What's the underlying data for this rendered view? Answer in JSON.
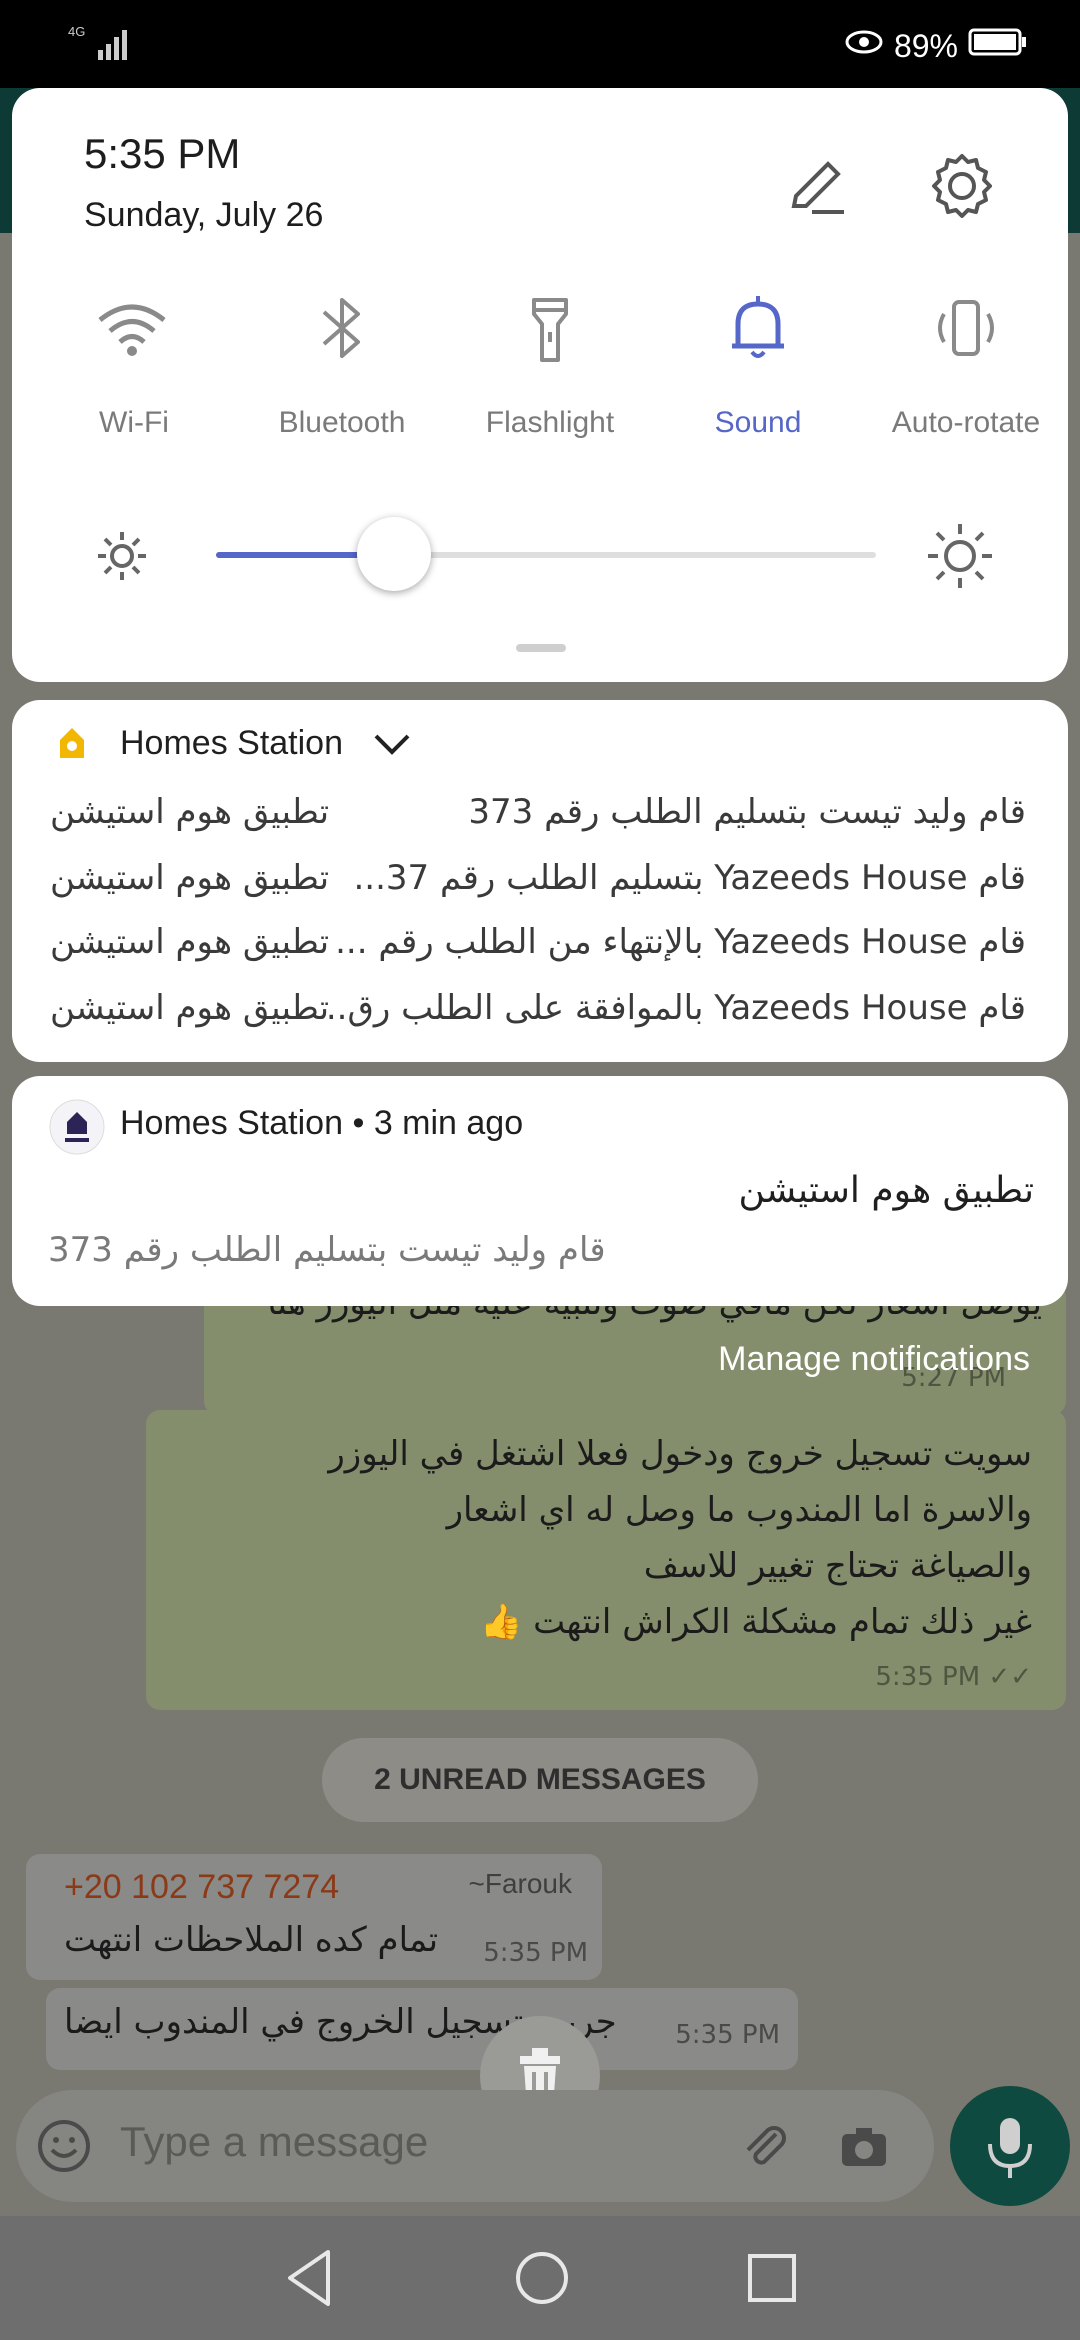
{
  "status_bar": {
    "network": "4G",
    "battery": "89%"
  },
  "quick_settings": {
    "time": "5:35 PM",
    "date": "Sunday, July 26",
    "tiles": [
      {
        "label": "Wi-Fi",
        "icon": "wifi-icon",
        "active": false
      },
      {
        "label": "Bluetooth",
        "icon": "bluetooth-icon",
        "active": false
      },
      {
        "label": "Flashlight",
        "icon": "flashlight-icon",
        "active": false
      },
      {
        "label": "Sound",
        "icon": "bell-icon",
        "active": true
      },
      {
        "label": "Auto-rotate",
        "icon": "auto-rotate-icon",
        "active": false
      }
    ],
    "brightness_level": 0.27,
    "accent_color": "#5567c8"
  },
  "notification_group": {
    "app_name": "Homes Station",
    "rows": [
      {
        "title": "تطبيق هوم استيشن",
        "text": "قام وليد تيست بتسليم الطلب رقم 373"
      },
      {
        "title": "تطبيق هوم استيشن",
        "text": "قام Yazeeds House بتسليم الطلب رقم 37..."
      },
      {
        "title": "تطبيق هوم استيشن",
        "text": "قام Yazeeds House بالإنتهاء من الطلب رقم ..."
      },
      {
        "title": "تطبيق هوم استيشن",
        "text": "قام Yazeeds House بالموافقة على الطلب رق.."
      }
    ]
  },
  "notification_single": {
    "app_name": "Homes Station",
    "time": "3 min ago",
    "title": "تطبيق هوم استيشن",
    "text": "قام وليد تيست بتسليم الطلب رقم 373"
  },
  "manage_notifications": "Manage notifications",
  "chat": {
    "partial_message": "يوصل اشعار لكن مافي صوت وتنبيه عليه مثل اليوزر هنا",
    "partial_time": "5:27 PM",
    "message_lines": [
      "سويت تسجيل خروج ودخول فعلا اشتغل في اليوزر",
      "والاسرة اما المندوب ما وصل له اي اشعار",
      "والصياغة تحتاج تغيير للاسف",
      "غير ذلك تمام مشكلة الكراش انتهت"
    ],
    "message_time": "5:35 PM",
    "unread_label": "2 UNREAD MESSAGES",
    "incoming_sender": "+20 102 737 7274",
    "incoming_name": "~Farouk",
    "incoming_text": "تمام كده الملاحظات انتهت",
    "incoming_time": "5:35 PM",
    "incoming2_text": "جربت تسجيل الخروج في المندوب ايضا",
    "incoming2_time": "5:35 PM",
    "input_placeholder": "Type a message"
  }
}
